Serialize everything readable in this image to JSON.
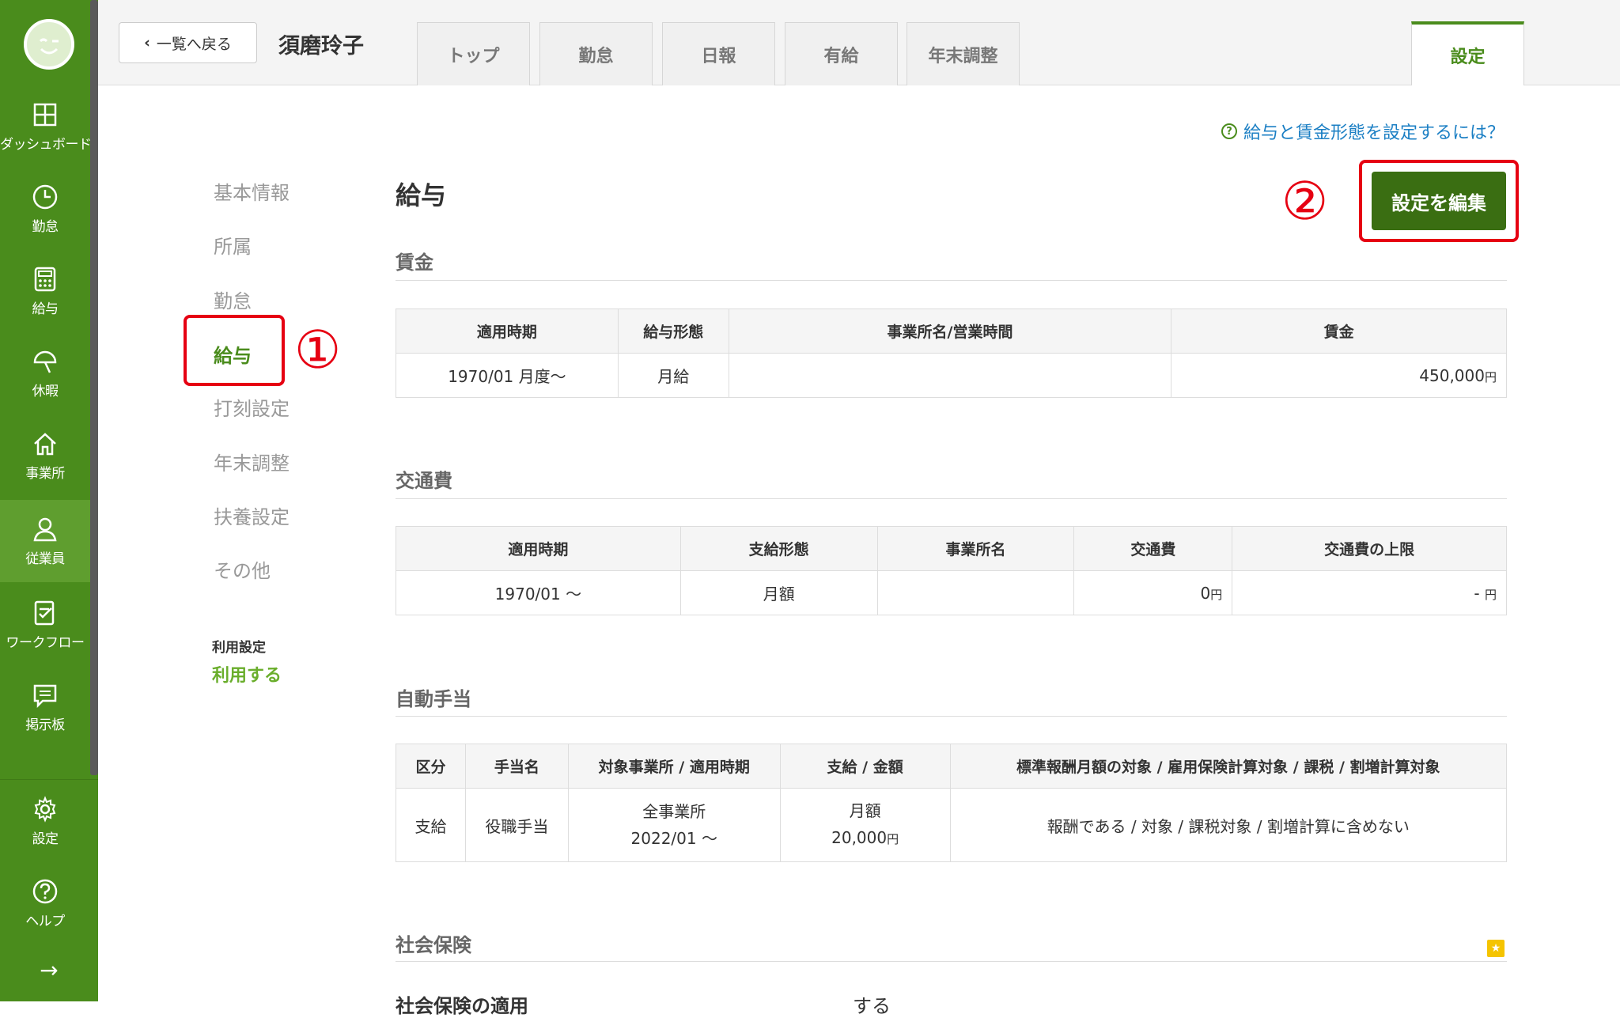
{
  "sidebar": {
    "items": [
      {
        "label": "ダッシュボード",
        "icon": "dashboard-icon"
      },
      {
        "label": "勤怠",
        "icon": "clock-icon"
      },
      {
        "label": "給与",
        "icon": "calculator-icon"
      },
      {
        "label": "休暇",
        "icon": "umbrella-icon"
      },
      {
        "label": "事業所",
        "icon": "home-icon"
      },
      {
        "label": "従業員",
        "icon": "person-icon"
      },
      {
        "label": "ワークフロー",
        "icon": "checklist-icon"
      },
      {
        "label": "掲示板",
        "icon": "message-icon"
      }
    ],
    "bottom_items": [
      {
        "label": "設定",
        "icon": "gear-icon"
      },
      {
        "label": "ヘルプ",
        "icon": "help-circle-icon"
      }
    ],
    "active_item": "従業員",
    "expand_arrow": "→"
  },
  "header": {
    "back_label": "一覧へ戻る",
    "employee_name": "須磨玲子",
    "tabs": [
      "トップ",
      "勤怠",
      "日報",
      "有給",
      "年末調整"
    ],
    "settings_tab": "設定"
  },
  "help_link": "給与と賃金形態を設定するには？",
  "submenu": {
    "items": [
      "基本情報",
      "所属",
      "勤怠",
      "給与",
      "打刻設定",
      "年末調整",
      "扶養設定",
      "その他"
    ],
    "active": "給与",
    "usage_label": "利用設定",
    "usage_value": "利用する"
  },
  "annotations": {
    "one": "①",
    "two": "②"
  },
  "main": {
    "title": "給与",
    "edit_button": "設定を編集",
    "wage": {
      "title": "賃金",
      "headers": [
        "適用時期",
        "給与形態",
        "事業所名/営業時間",
        "賃金"
      ],
      "row": {
        "period": "1970/01 月度〜",
        "type": "月給",
        "office": "",
        "amount": "450,000",
        "unit": "円"
      }
    },
    "transport": {
      "title": "交通費",
      "headers": [
        "適用時期",
        "支給形態",
        "事業所名",
        "交通費",
        "交通費の上限"
      ],
      "row": {
        "period": "1970/01 〜",
        "type": "月額",
        "office": "",
        "amount": "0",
        "unit": "円",
        "limit": "- ",
        "limit_unit": "円"
      }
    },
    "allowance": {
      "title": "自動手当",
      "headers": [
        "区分",
        "手当名",
        "対象事業所 / 適用時期",
        "支給 / 金額",
        "標準報酬月額の対象 / 雇用保険計算対象 / 課税 / 割増計算対象"
      ],
      "row": {
        "kind": "支給",
        "name": "役職手当",
        "office": "全事業所",
        "period": "2022/01 〜",
        "pay_type": "月額",
        "amount": "20,000",
        "unit": "円",
        "flags": "報酬である / 対象 / 課税対象 / 割増計算に含めない"
      }
    },
    "social_insurance": {
      "title": "社会保険",
      "row_label": "社会保険の適用",
      "row_value": "する"
    }
  },
  "colors": {
    "brand": "#4a8c1c",
    "annotation": "#e60012",
    "link": "#1b7fc4"
  }
}
